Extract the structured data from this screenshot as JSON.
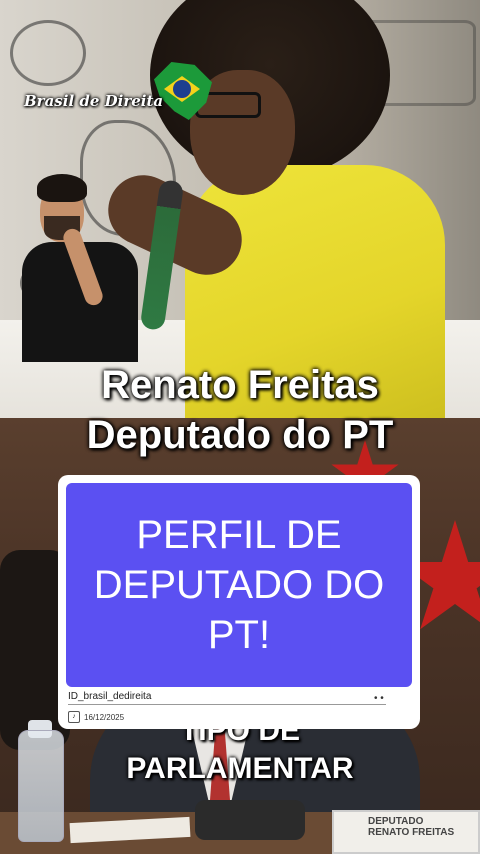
{
  "watermark": {
    "brand_name": "Brasil de Direita"
  },
  "headline": {
    "line1": "Renato Freitas",
    "line2": "Deputado do PT"
  },
  "card": {
    "text": "PERFIL DE DEPUTADO DO PT!",
    "id_label": "ID_brasil_dedireita",
    "dots": "• •",
    "date": "16/12/2025",
    "platform_icon": "tiktok-icon"
  },
  "caption": {
    "line1": "TIPO DE",
    "line2": "PARLAMENTAR"
  },
  "nameplate": {
    "line1": "DEPUTADO",
    "line2": "RENATO FREITAS"
  },
  "colors": {
    "card_bg": "#5b50f2",
    "shirt_yellow": "#e4d52a",
    "star_red": "#c3201d",
    "brazil_green": "#1c9a3a",
    "brazil_yellow": "#f3d21b",
    "brazil_blue": "#1d3f8f"
  }
}
